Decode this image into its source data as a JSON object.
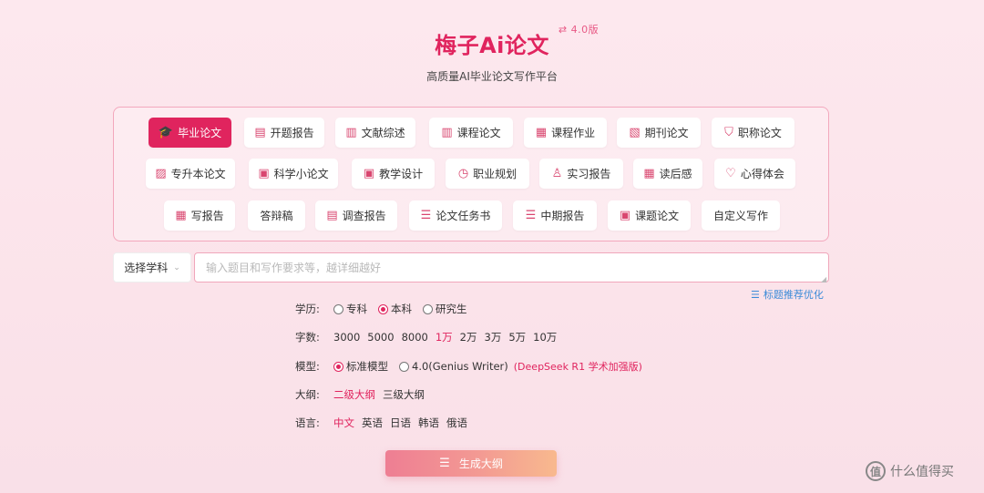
{
  "header": {
    "title": "梅子Ai论文",
    "version": "⇄ 4.0版",
    "subtitle": "高质量AI毕业论文写作平台"
  },
  "paper_types": [
    {
      "label": "毕业论文",
      "icon": "graduation-cap-icon",
      "active": true
    },
    {
      "label": "开题报告",
      "icon": "report-icon"
    },
    {
      "label": "文献综述",
      "icon": "document-icon"
    },
    {
      "label": "课程论文",
      "icon": "document-icon"
    },
    {
      "label": "课程作业",
      "icon": "document-search-icon"
    },
    {
      "label": "期刊论文",
      "icon": "journal-icon"
    },
    {
      "label": "职称论文",
      "icon": "badge-icon"
    },
    {
      "label": "专升本论文",
      "icon": "document-check-icon"
    },
    {
      "label": "科学小论文",
      "icon": "book-icon"
    },
    {
      "label": "教学设计",
      "icon": "book-icon"
    },
    {
      "label": "职业规划",
      "icon": "clock-icon"
    },
    {
      "label": "实习报告",
      "icon": "user-icon"
    },
    {
      "label": "读后感",
      "icon": "calendar-icon"
    },
    {
      "label": "心得体会",
      "icon": "heart-icon"
    },
    {
      "label": "写报告",
      "icon": "document-search-icon"
    },
    {
      "label": "答辩稿",
      "icon": ""
    },
    {
      "label": "调查报告",
      "icon": "report-icon"
    },
    {
      "label": "论文任务书",
      "icon": "list-document-icon"
    },
    {
      "label": "中期报告",
      "icon": "list-document-icon"
    },
    {
      "label": "课题论文",
      "icon": "book-icon"
    },
    {
      "label": "自定义写作",
      "icon": ""
    }
  ],
  "subject_select": {
    "label": "选择学科"
  },
  "topic_input": {
    "value": "",
    "placeholder": "输入题目和写作要求等，越详细越好"
  },
  "recommend_link": "标题推荐优化",
  "options": {
    "education": {
      "label": "学历:",
      "items": [
        "专科",
        "本科",
        "研究生"
      ],
      "selected": "本科"
    },
    "words": {
      "label": "字数:",
      "items": [
        "3000",
        "5000",
        "8000",
        "1万",
        "2万",
        "3万",
        "5万",
        "10万"
      ],
      "selected": "1万"
    },
    "model": {
      "label": "模型:",
      "items": [
        "标准模型",
        "4.0(Genius Writer)"
      ],
      "selected": "标准模型",
      "note": "(DeepSeek R1 学术加强版)"
    },
    "outline": {
      "label": "大纲:",
      "items": [
        "二级大纲",
        "三级大纲"
      ],
      "selected": "二级大纲"
    },
    "language": {
      "label": "语言:",
      "items": [
        "中文",
        "英语",
        "日语",
        "韩语",
        "俄语"
      ],
      "selected": "中文"
    }
  },
  "generate_button": "生成大纲",
  "watermark": {
    "logo": "值",
    "text": "什么值得买"
  },
  "colors": {
    "accent": "#e0245e",
    "link": "#3b8bd8",
    "panel_border": "#f3a8bd"
  }
}
